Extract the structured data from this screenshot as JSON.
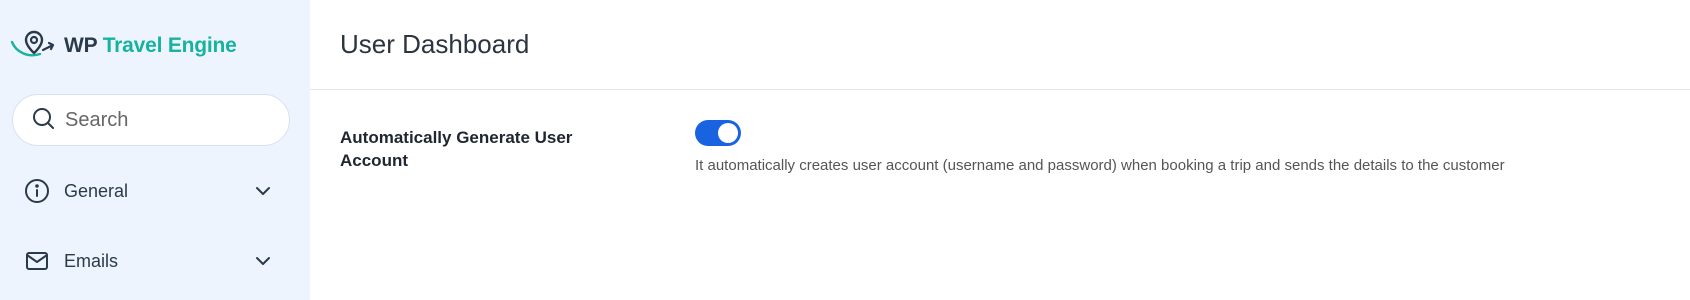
{
  "app": {
    "logo_wp": "WP",
    "logo_brand": "Travel Engine"
  },
  "search": {
    "placeholder": "Search",
    "value": ""
  },
  "sidebar": {
    "items": [
      {
        "label": "General",
        "icon": "info-icon"
      },
      {
        "label": "Emails",
        "icon": "mail-icon"
      }
    ]
  },
  "main": {
    "title": "User Dashboard",
    "setting": {
      "label": "Automatically Generate User Account",
      "enabled": true,
      "description": "It automatically creates user account (username and password) when booking a trip and sends the details to the customer"
    }
  },
  "colors": {
    "sidebar_bg": "#edf4fe",
    "brand_teal": "#17b3a0",
    "toggle_on": "#1a63e0"
  }
}
